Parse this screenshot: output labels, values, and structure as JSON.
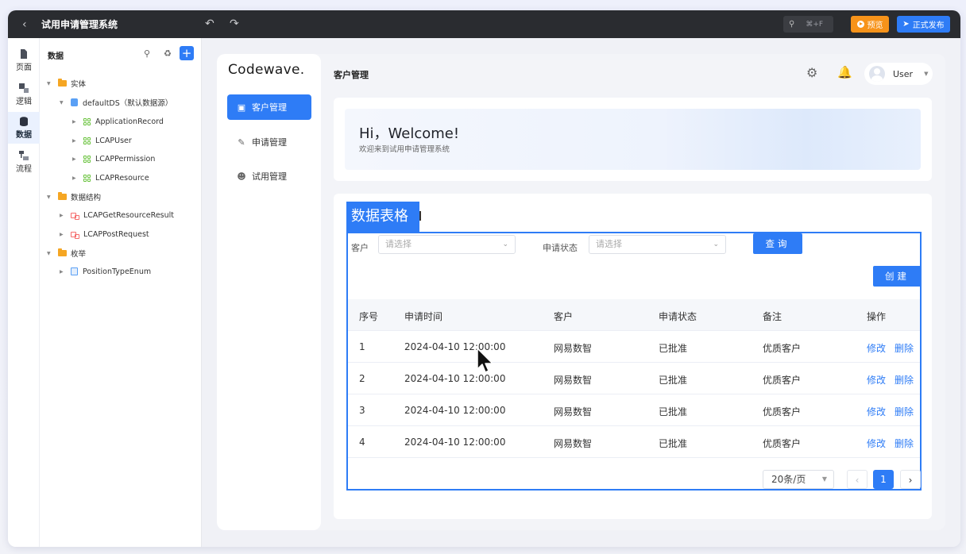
{
  "topbar": {
    "back_icon": "chevron-left-icon",
    "title": "试用申请管理系统",
    "search_shortcut": "⌘+F",
    "preview_label": "预览",
    "publish_label": "正式发布",
    "colors": {
      "bar": "#2a2c30",
      "preview": "#f7931a",
      "publish": "#2e7cf6"
    }
  },
  "rail": {
    "items": [
      {
        "label": "页面",
        "icon": "page-icon"
      },
      {
        "label": "逻辑",
        "icon": "logic-icon"
      },
      {
        "label": "数据",
        "icon": "database-icon",
        "active": true
      },
      {
        "label": "流程",
        "icon": "flow-icon"
      }
    ]
  },
  "tree": {
    "header": "数据",
    "nodes": [
      {
        "label": "实体",
        "type": "folder"
      },
      {
        "label": "defaultDS（默认数据源）",
        "type": "datasource"
      },
      {
        "label": "ApplicationRecord",
        "type": "entity"
      },
      {
        "label": "LCAPUser",
        "type": "entity"
      },
      {
        "label": "LCAPPermission",
        "type": "entity"
      },
      {
        "label": "LCAPResource",
        "type": "entity"
      },
      {
        "label": "数据结构",
        "type": "folder"
      },
      {
        "label": "LCAPGetResourceResult",
        "type": "structure"
      },
      {
        "label": "LCAPPostRequest",
        "type": "structure"
      },
      {
        "label": "枚举",
        "type": "folder"
      },
      {
        "label": "PositionTypeEnum",
        "type": "enum"
      }
    ]
  },
  "app": {
    "logo": "Codewave.",
    "menu": [
      {
        "label": "客户管理",
        "active": true
      },
      {
        "label": "申请管理"
      },
      {
        "label": "试用管理"
      }
    ],
    "page_title": "客户管理",
    "user": "User",
    "welcome": {
      "title": "Hi，Welcome!",
      "subtitle": "欢迎来到试用申请管理系统"
    },
    "selection_tag": "数据表格",
    "filters": {
      "customer_label": "客户",
      "customer_placeholder": "请选择",
      "status_label": "申请状态",
      "status_placeholder": "请选择",
      "query_label": "查询",
      "create_label": "创建"
    },
    "table": {
      "columns": [
        "序号",
        "申请时间",
        "客户",
        "申请状态",
        "备注",
        "操作"
      ],
      "rows": [
        {
          "no": "1",
          "time": "2024-04-10 12:00:00",
          "customer": "网易数智",
          "status": "已批准",
          "note": "优质客户"
        },
        {
          "no": "2",
          "time": "2024-04-10 12:00:00",
          "customer": "网易数智",
          "status": "已批准",
          "note": "优质客户"
        },
        {
          "no": "3",
          "time": "2024-04-10 12:00:00",
          "customer": "网易数智",
          "status": "已批准",
          "note": "优质客户"
        },
        {
          "no": "4",
          "time": "2024-04-10 12:00:00",
          "customer": "网易数智",
          "status": "已批准",
          "note": "优质客户"
        }
      ],
      "edit_label": "修改",
      "delete_label": "删除"
    },
    "pagination": {
      "page_size": "20条/页",
      "current_page": "1",
      "prev_icon": "chevron-left-icon",
      "next_icon": "chevron-right-icon"
    }
  }
}
